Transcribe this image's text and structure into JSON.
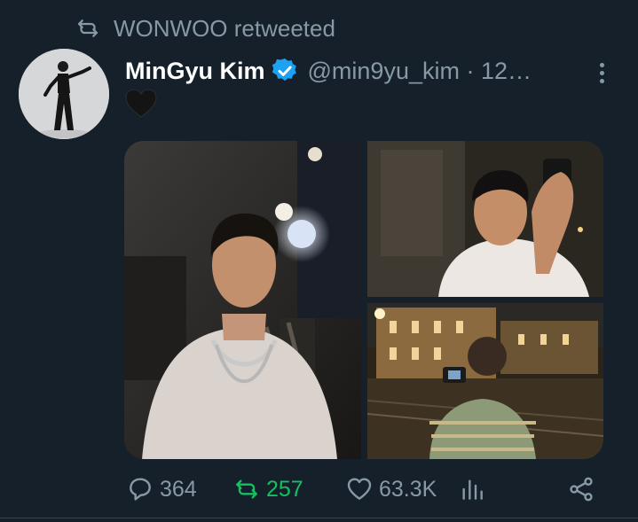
{
  "retweet_header": {
    "icon": "retweet-icon",
    "text": "WONWOO retweeted"
  },
  "tweet": {
    "author_name": "MinGyu Kim",
    "verified": true,
    "handle_time": "@min9yu_kim · 12…",
    "emoji_text": "🖤",
    "media": [
      {
        "alt": "photo-portrait-night"
      },
      {
        "alt": "photo-camera-selfie"
      },
      {
        "alt": "photo-street-camera"
      }
    ],
    "actions": {
      "replies": "364",
      "retweets": "257",
      "likes": "63.3K"
    }
  },
  "colors": {
    "background": "#15202b",
    "secondary_text": "#8899a6",
    "retweet_green": "#17bf63",
    "verified_blue": "#1da1f2"
  }
}
